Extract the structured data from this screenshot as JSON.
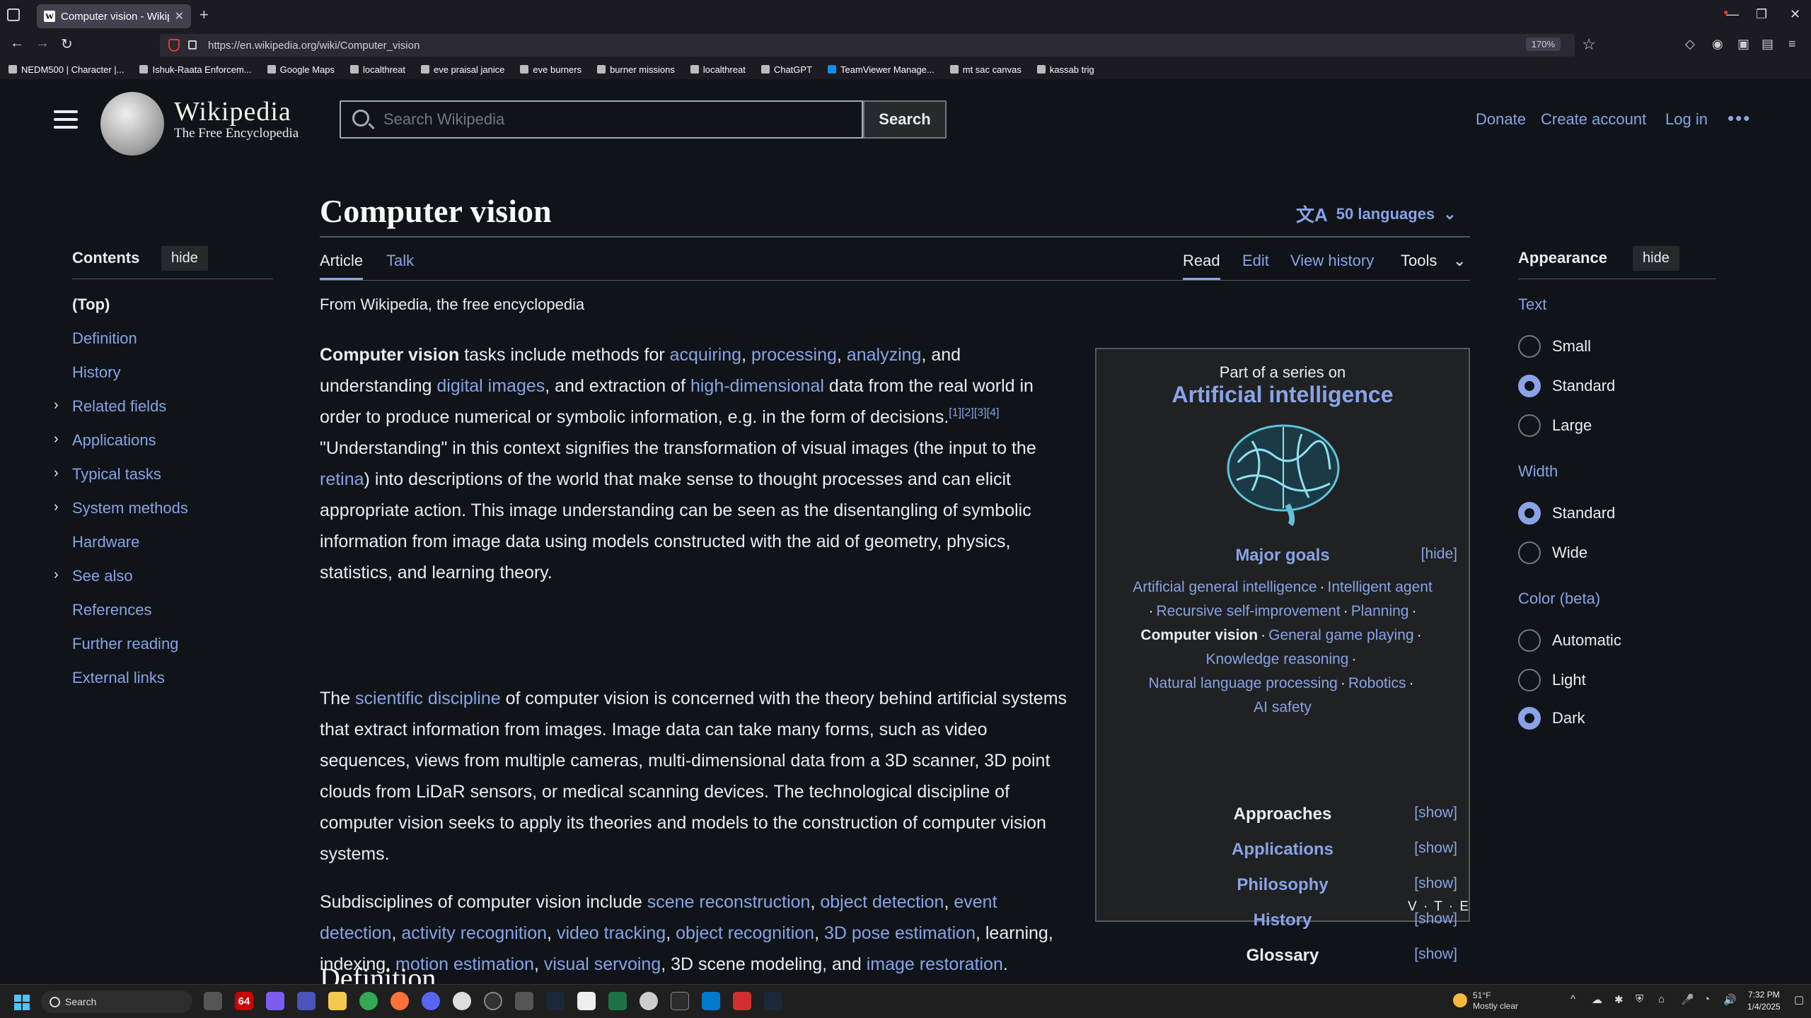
{
  "browser": {
    "tab_title": "Computer vision - Wikipedia",
    "url": "https://en.wikipedia.org/wiki/Computer_vision",
    "zoom": "170%",
    "bookmarks": [
      "NEDM500 | Character |...",
      "Ishuk-Raata Enforcem...",
      "Google Maps",
      "localthreat",
      "eve praisal janice",
      "eve burners",
      "burner missions",
      "localthreat",
      "ChatGPT",
      "TeamViewer Manage...",
      "mt sac canvas",
      "kassab trig"
    ]
  },
  "header": {
    "wordmark": "Wikipedia",
    "tagline": "The Free Encyclopedia",
    "search_placeholder": "Search Wikipedia",
    "search_button": "Search",
    "donate": "Donate",
    "create_account": "Create account",
    "log_in": "Log in",
    "more": "•••"
  },
  "toc": {
    "heading": "Contents",
    "hide": "hide",
    "items": [
      "(Top)",
      "Definition",
      "History",
      "Related fields",
      "Applications",
      "Typical tasks",
      "System methods",
      "Hardware",
      "See also",
      "References",
      "Further reading",
      "External links"
    ]
  },
  "article": {
    "title": "Computer vision",
    "languages": "50 languages",
    "tab_article": "Article",
    "tab_talk": "Talk",
    "tab_read": "Read",
    "tab_edit": "Edit",
    "tab_history": "View history",
    "tab_tools": "Tools",
    "from": "From Wikipedia, the free encyclopedia",
    "next_heading": "Definition"
  },
  "infobox": {
    "pre": "Part of a series on",
    "main": "Artificial intelligence",
    "major_goals": "Major goals",
    "hide": "[hide]",
    "show": "[show]",
    "approaches": "Approaches",
    "applications": "Applications",
    "philosophy": "Philosophy",
    "history": "History",
    "glossary": "Glossary",
    "vte": "V · T · E",
    "goal_links": [
      "Artificial general intelligence",
      "Intelligent agent",
      "Recursive self-improvement",
      "Planning",
      "Computer vision",
      "General game playing",
      "Knowledge reasoning",
      "Natural language processing",
      "Robotics",
      "AI safety"
    ]
  },
  "appearance": {
    "heading": "Appearance",
    "hide": "hide",
    "text_label": "Text",
    "small": "Small",
    "standard": "Standard",
    "large": "Large",
    "width_label": "Width",
    "width_standard": "Standard",
    "wide": "Wide",
    "color_label": "Color (beta)",
    "automatic": "Automatic",
    "light": "Light",
    "dark": "Dark"
  },
  "taskbar": {
    "search": "Search",
    "badge": "64",
    "temp": "51°F",
    "condition": "Mostly clear",
    "time": "7:32 PM",
    "date": "1/4/2025"
  }
}
